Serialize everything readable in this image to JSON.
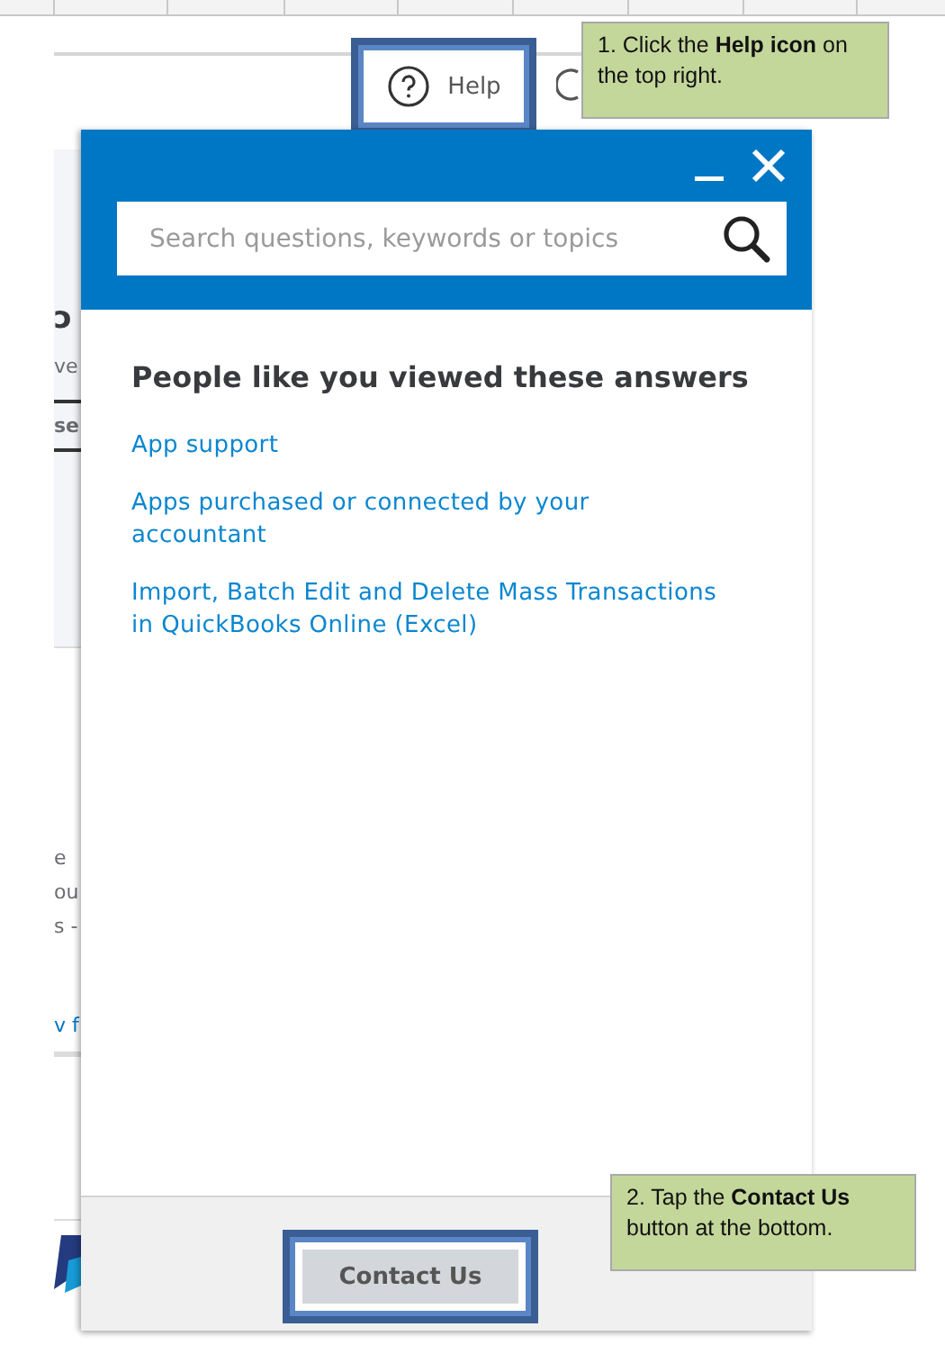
{
  "background_page": {
    "fragments": [
      {
        "kind": "heading",
        "text": "ɔ"
      },
      {
        "kind": "muted",
        "text": "ve"
      },
      {
        "kind": "tab",
        "text": "se"
      },
      {
        "kind": "muted",
        "text": "e"
      },
      {
        "kind": "muted",
        "text": "ou"
      },
      {
        "kind": "muted",
        "text": "s -"
      },
      {
        "kind": "link",
        "text": "v f"
      }
    ]
  },
  "help_button": {
    "label": "Help",
    "highlighted": true
  },
  "callouts": [
    {
      "text": "1. Click the **Help icon** on the top right."
    },
    {
      "text": "2. Tap the **Contact Us** button at the bottom."
    }
  ],
  "help_panel": {
    "search": {
      "placeholder": "Search questions, keywords or topics"
    },
    "heading": "People like you viewed these answers",
    "links": [
      "App support",
      "Apps purchased or connected by your accountant",
      "Import, Batch Edit and Delete Mass Transactions in QuickBooks Online (Excel)"
    ],
    "contact_button": {
      "label": "Contact Us",
      "highlighted": true
    }
  }
}
